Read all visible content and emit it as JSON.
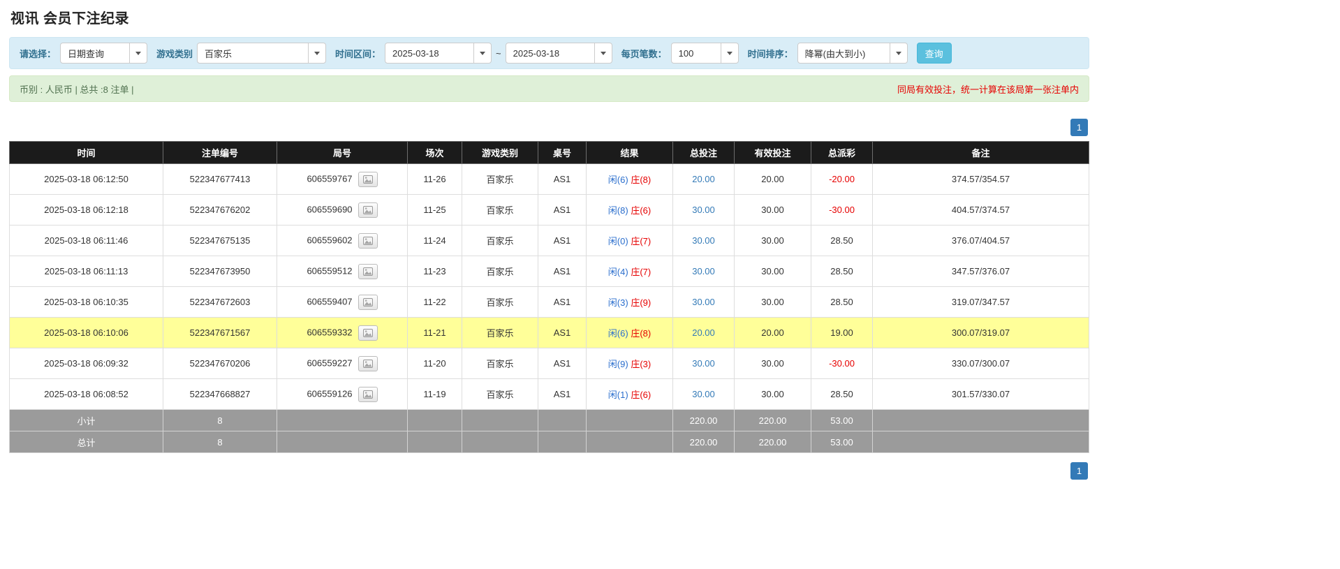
{
  "title": "视讯 会员下注纪录",
  "filters": {
    "select_label": "请选择：",
    "select_value": "日期查询",
    "game_label": "游戏类别",
    "game_value": "百家乐",
    "range_label": "时间区间：",
    "date_from": "2025-03-18",
    "range_separator": "~",
    "date_to": "2025-03-18",
    "per_page_label": "每页笔数：",
    "per_page_value": "100",
    "sort_label": "时间排序：",
    "sort_value": "降幂(由大到小)",
    "search_button": "查询"
  },
  "info": {
    "left": "币别 : 人民币 | 总共 :8 注单 |",
    "right": "同局有效投注，统一计算在该局第一张注单内"
  },
  "pagination": {
    "current_page": "1"
  },
  "icons": {
    "dropdown_caret": "caret-down",
    "round_view": "image-icon"
  },
  "table": {
    "headers": [
      "时间",
      "注单编号",
      "局号",
      "场次",
      "游戏类别",
      "桌号",
      "结果",
      "总投注",
      "有效投注",
      "总派彩",
      "备注"
    ],
    "rows": [
      {
        "time": "2025-03-18 06:12:50",
        "bet_id": "522347677413",
        "round_id": "606559767",
        "session": "11-26",
        "game": "百家乐",
        "table_no": "AS1",
        "result_player": "闲(6)",
        "result_banker": "庄(8)",
        "total_bet": "20.00",
        "valid_bet": "20.00",
        "payout": "-20.00",
        "remark": "374.57/354.57",
        "highlighted": false
      },
      {
        "time": "2025-03-18 06:12:18",
        "bet_id": "522347676202",
        "round_id": "606559690",
        "session": "11-25",
        "game": "百家乐",
        "table_no": "AS1",
        "result_player": "闲(8)",
        "result_banker": "庄(6)",
        "total_bet": "30.00",
        "valid_bet": "30.00",
        "payout": "-30.00",
        "remark": "404.57/374.57",
        "highlighted": false
      },
      {
        "time": "2025-03-18 06:11:46",
        "bet_id": "522347675135",
        "round_id": "606559602",
        "session": "11-24",
        "game": "百家乐",
        "table_no": "AS1",
        "result_player": "闲(0)",
        "result_banker": "庄(7)",
        "total_bet": "30.00",
        "valid_bet": "30.00",
        "payout": "28.50",
        "remark": "376.07/404.57",
        "highlighted": false
      },
      {
        "time": "2025-03-18 06:11:13",
        "bet_id": "522347673950",
        "round_id": "606559512",
        "session": "11-23",
        "game": "百家乐",
        "table_no": "AS1",
        "result_player": "闲(4)",
        "result_banker": "庄(7)",
        "total_bet": "30.00",
        "valid_bet": "30.00",
        "payout": "28.50",
        "remark": "347.57/376.07",
        "highlighted": false
      },
      {
        "time": "2025-03-18 06:10:35",
        "bet_id": "522347672603",
        "round_id": "606559407",
        "session": "11-22",
        "game": "百家乐",
        "table_no": "AS1",
        "result_player": "闲(3)",
        "result_banker": "庄(9)",
        "total_bet": "30.00",
        "valid_bet": "30.00",
        "payout": "28.50",
        "remark": "319.07/347.57",
        "highlighted": false
      },
      {
        "time": "2025-03-18 06:10:06",
        "bet_id": "522347671567",
        "round_id": "606559332",
        "session": "11-21",
        "game": "百家乐",
        "table_no": "AS1",
        "result_player": "闲(6)",
        "result_banker": "庄(8)",
        "total_bet": "20.00",
        "valid_bet": "20.00",
        "payout": "19.00",
        "remark": "300.07/319.07",
        "highlighted": true
      },
      {
        "time": "2025-03-18 06:09:32",
        "bet_id": "522347670206",
        "round_id": "606559227",
        "session": "11-20",
        "game": "百家乐",
        "table_no": "AS1",
        "result_player": "闲(9)",
        "result_banker": "庄(3)",
        "total_bet": "30.00",
        "valid_bet": "30.00",
        "payout": "-30.00",
        "remark": "330.07/300.07",
        "highlighted": false
      },
      {
        "time": "2025-03-18 06:08:52",
        "bet_id": "522347668827",
        "round_id": "606559126",
        "session": "11-19",
        "game": "百家乐",
        "table_no": "AS1",
        "result_player": "闲(1)",
        "result_banker": "庄(6)",
        "total_bet": "30.00",
        "valid_bet": "30.00",
        "payout": "28.50",
        "remark": "301.57/330.07",
        "highlighted": false
      }
    ],
    "summary_rows": [
      {
        "label": "小计",
        "count": "8",
        "total_bet": "220.00",
        "valid_bet": "220.00",
        "payout": "53.00"
      },
      {
        "label": "总计",
        "count": "8",
        "total_bet": "220.00",
        "valid_bet": "220.00",
        "payout": "53.00"
      }
    ]
  }
}
